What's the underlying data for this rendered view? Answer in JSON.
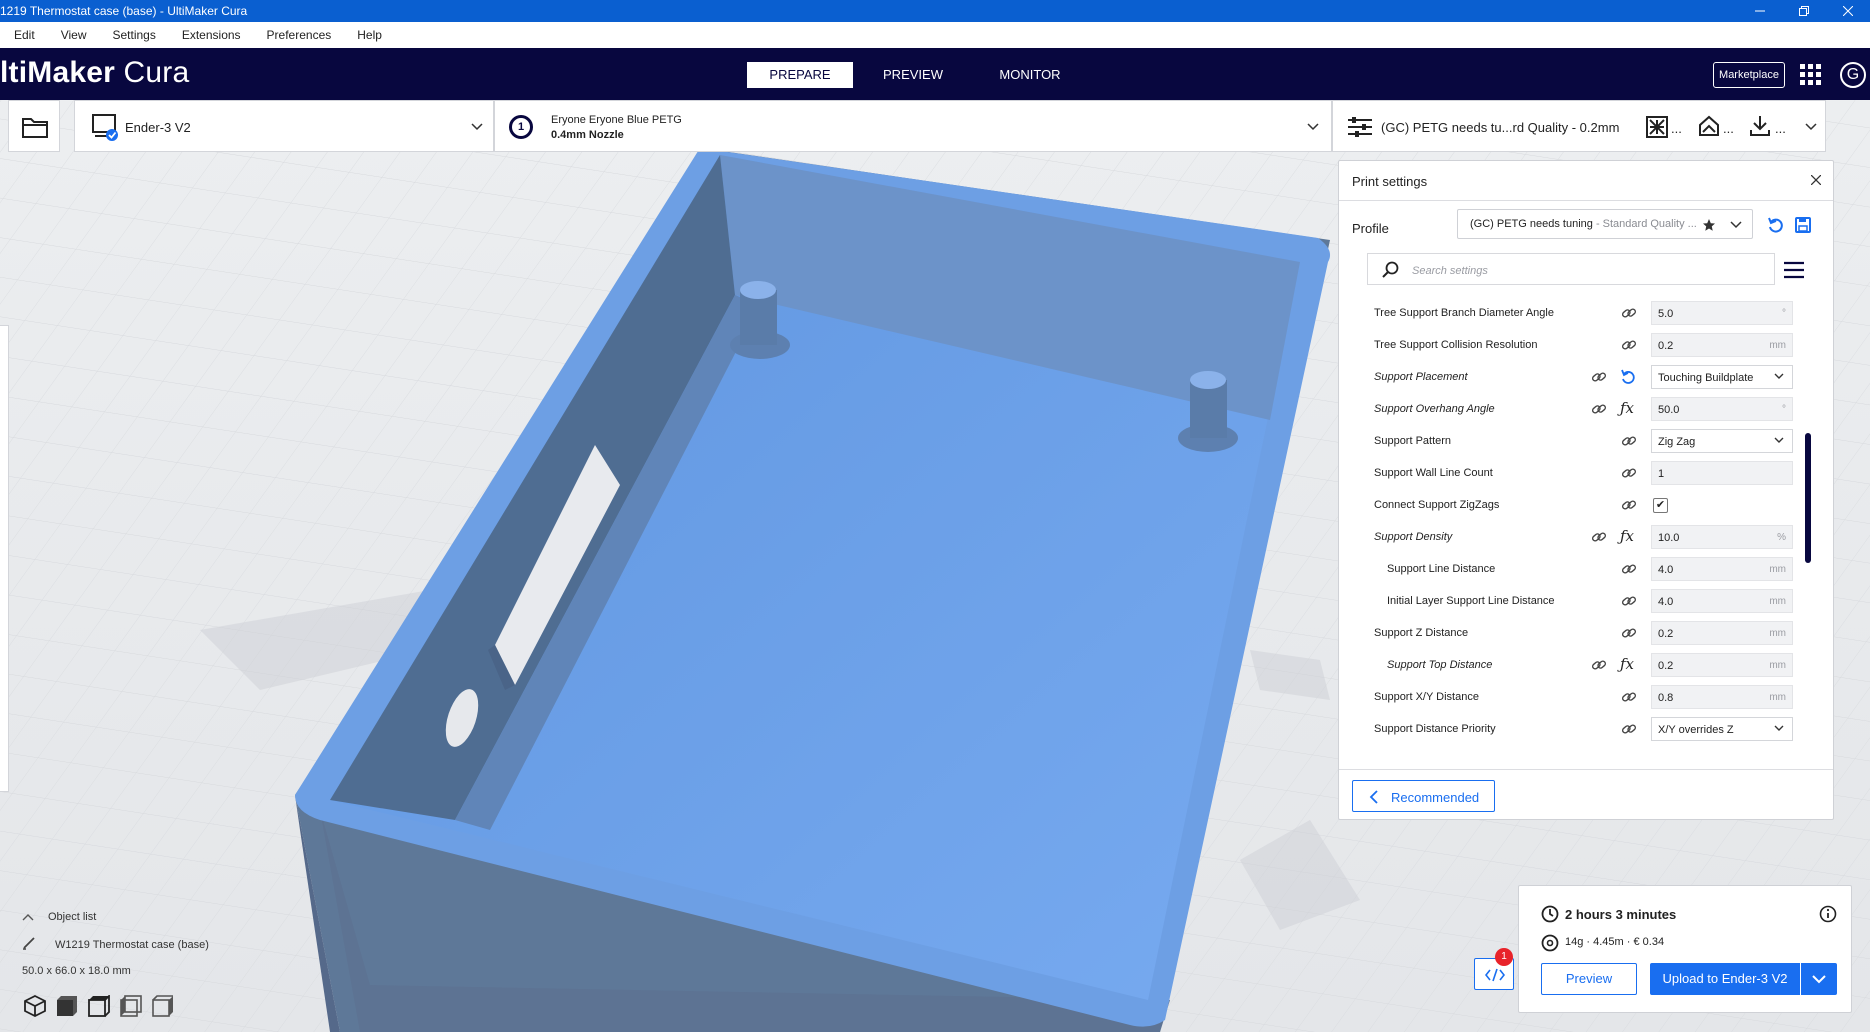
{
  "window": {
    "title": "1219 Thermostat case (base) - UltiMaker Cura",
    "controls": [
      "minimize",
      "restore",
      "close"
    ]
  },
  "menubar": {
    "items": [
      "Edit",
      "View",
      "Settings",
      "Extensions",
      "Preferences",
      "Help"
    ]
  },
  "header": {
    "logo_bold": "ltiMaker",
    "logo_light": " Cura",
    "tabs": [
      "PREPARE",
      "PREVIEW",
      "MONITOR"
    ],
    "active_tab": "PREPARE",
    "marketplace_label": "Marketplace",
    "account_initial": "G"
  },
  "stagebar": {
    "printer_name": "Ender-3 V2",
    "material_name": "Eryone Eryone Blue PETG",
    "nozzle": "0.4mm Nozzle",
    "extruder_number": "1",
    "profile_summary": "(GC) PETG needs tu...rd Quality - 0.2mm",
    "support_ellipsis": "...",
    "adhesion_ellipsis": "...",
    "ellipsis": "..."
  },
  "print_settings": {
    "title": "Print settings",
    "profile_label": "Profile",
    "profile_name": "(GC) PETG needs tuning",
    "profile_quality": " - Standard Quality ...",
    "search_placeholder": "Search settings",
    "recommended_label": "Recommended",
    "settings": [
      {
        "label": "Tree Support Branch Diameter Angle",
        "value": "5.0",
        "unit": "°",
        "type": "field"
      },
      {
        "label": "Tree Support Collision Resolution",
        "value": "0.2",
        "unit": "mm",
        "type": "field"
      },
      {
        "label": "Support Placement",
        "value": "Touching Buildplate",
        "unit": "",
        "type": "dropdown"
      },
      {
        "label": "Support Overhang Angle",
        "value": "50.0",
        "unit": "°",
        "type": "field"
      },
      {
        "label": "Support Pattern",
        "value": "Zig Zag",
        "unit": "",
        "type": "dropdown"
      },
      {
        "label": "Support Wall Line Count",
        "value": "1",
        "unit": "",
        "type": "field"
      },
      {
        "label": "Connect Support ZigZags",
        "value": "✔",
        "unit": "",
        "type": "checkbox"
      },
      {
        "label": "Support Density",
        "value": "10.0",
        "unit": "%",
        "type": "field"
      },
      {
        "label": "Support Line Distance",
        "value": "4.0",
        "unit": "mm",
        "type": "field"
      },
      {
        "label": "Initial Layer Support Line Distance",
        "value": "4.0",
        "unit": "mm",
        "type": "field"
      },
      {
        "label": "Support Z Distance",
        "value": "0.2",
        "unit": "mm",
        "type": "field"
      },
      {
        "label": "Support Top Distance",
        "value": "0.2",
        "unit": "mm",
        "type": "field"
      },
      {
        "label": "Support X/Y Distance",
        "value": "0.8",
        "unit": "mm",
        "type": "field"
      },
      {
        "label": "Support Distance Priority",
        "value": "X/Y overrides Z",
        "unit": "",
        "type": "dropdown"
      }
    ]
  },
  "object_list": {
    "header": "Object list",
    "object_name": "W1219 Thermostat case (base)",
    "dimensions": "50.0 x 66.0 x 18.0 mm"
  },
  "estimate": {
    "time": "2 hours 3 minutes",
    "material": "14g · 4.45m · € 0.34",
    "preview_label": "Preview",
    "upload_label": "Upload to Ender-3 V2",
    "badge_count": "1"
  },
  "colors": {
    "header_bg": "#08073f",
    "titlebar_bg": "#0a5fd0",
    "accent": "#196ef0",
    "model_blue": "#6a9fe6",
    "badge_red": "#e8232a"
  }
}
